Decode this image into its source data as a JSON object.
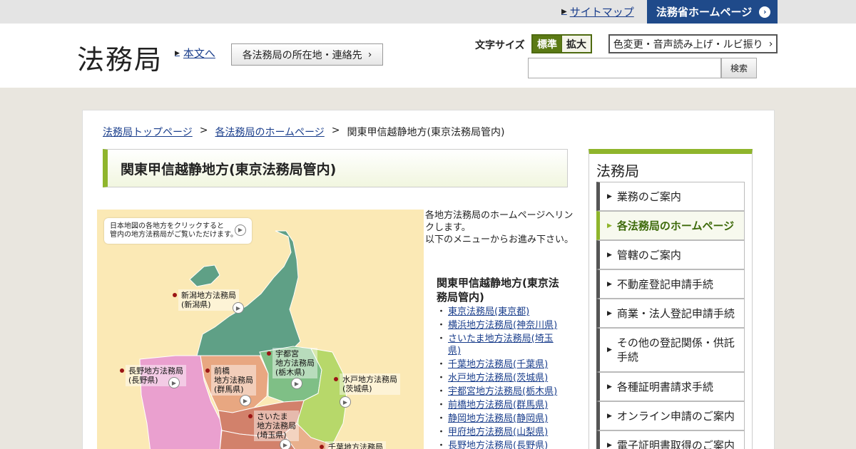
{
  "topbar": {
    "sitemap": "サイトマップ",
    "moj_homepage": "法務省ホームページ"
  },
  "header": {
    "logo": "法務局",
    "skip_to_content": "本文へ",
    "locations_button": "各法務局の所在地・連絡先",
    "font_size_label": "文字サイズ",
    "font_size_standard": "標準",
    "font_size_large": "拡大",
    "accessibility_button": "色変更・音声読み上げ・ルビ振り",
    "search_button": "検索",
    "search_value": ""
  },
  "breadcrumb": {
    "items": [
      "法務局トップページ",
      "各法務局のホームページ"
    ],
    "current": "関東甲信越静地方(東京法務局管内)",
    "separator": ">"
  },
  "page_title": "関東甲信越静地方(東京法務局管内)",
  "map": {
    "note_line1": "日本地図の各地方をクリックすると",
    "note_line2": "管内の地方法務局がご覧いただけます。",
    "labels": {
      "niigata": [
        "新潟地方法務局",
        "(新潟県)"
      ],
      "nagano": [
        "長野地方法務局",
        "(長野県)"
      ],
      "maebashi": [
        "前橋",
        "地方法務局",
        "(群馬県)"
      ],
      "utsunomiya": [
        "宇都宮",
        "地方法務局",
        "(栃木県)"
      ],
      "mito": [
        "水戸地方法務局",
        "(茨城県)"
      ],
      "saitama": [
        "さいたま",
        "地方法務局",
        "(埼玉県)"
      ],
      "chiba": [
        "千葉地方法務局"
      ]
    },
    "colors": {
      "background": "#fbe9b5",
      "niigata": "#5fa086",
      "nagano": "#eaa0cf",
      "gunma": "#e8a781",
      "tochigi": "#7fbf86",
      "ibaraki": "#b7d86a",
      "saitama": "#d2816b",
      "chiba": "#e9b08c"
    }
  },
  "intro": {
    "line1": "各地方法務局のホームページへリンクします。",
    "line2": "以下のメニューからお進み下さい。"
  },
  "region_heading": "関東甲信越静地方(東京法務局管内)",
  "offices": [
    "東京法務局(東京都)",
    "横浜地方法務局(神奈川県)",
    "さいたま地方法務局(埼玉県)",
    "千葉地方法務局(千葉県)",
    "水戸地方法務局(茨城県)",
    "宇都宮地方法務局(栃木県)",
    "前橋地方法務局(群馬県)",
    "静岡地方法務局(静岡県)",
    "甲府地方法務局(山梨県)",
    "長野地方法務局(長野県)"
  ],
  "sidebar": {
    "title": "法務局",
    "items": [
      "業務のご案内",
      "各法務局のホームページ",
      "管轄のご案内",
      "不動産登記申請手続",
      "商業・法人登記申請手続",
      "その他の登記関係・供託手続",
      "各種証明書請求手続",
      "オンライン申請のご案内",
      "電子証明書取得のご案内"
    ],
    "active_index": 1
  },
  "theme": {
    "accent_green": "#8fb52c",
    "nav_blue": "#1f4a8a",
    "link_blue": "#1a3e8c"
  }
}
